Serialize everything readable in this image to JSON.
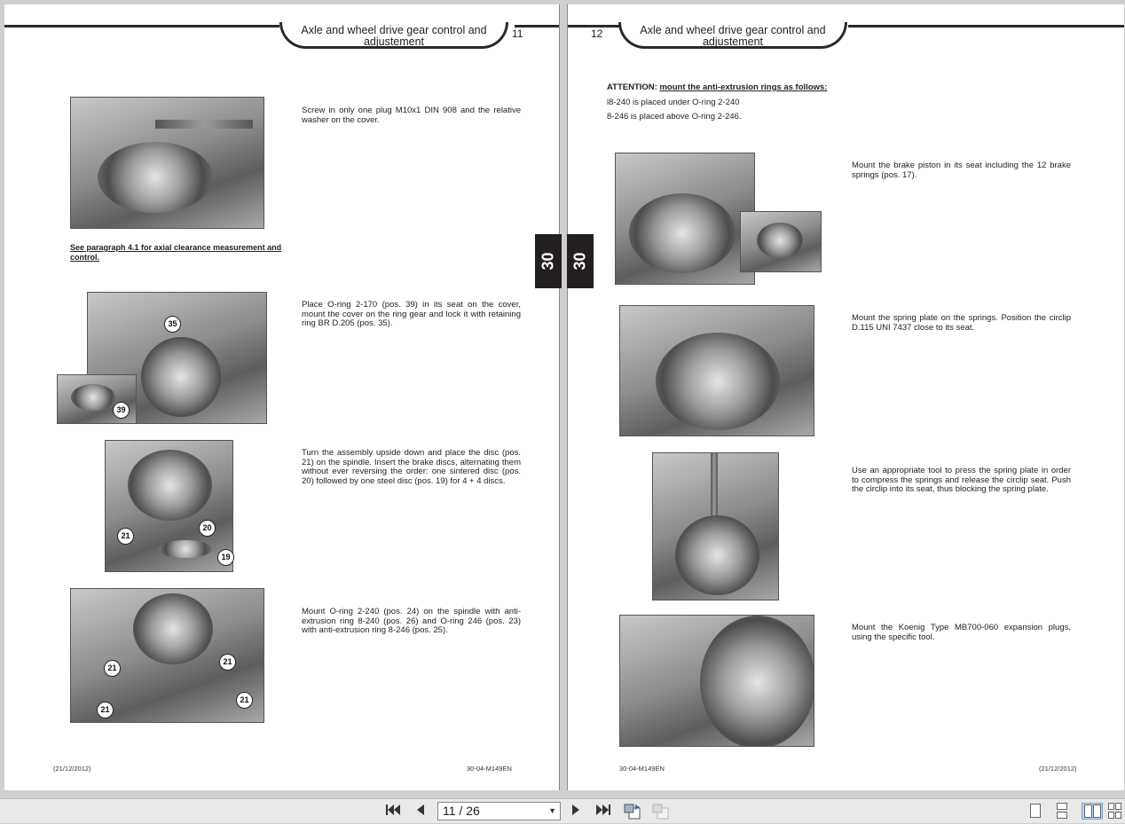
{
  "left_page": {
    "header_title": "Axle and wheel drive gear control and adjustement",
    "page_number": "11",
    "side_tab": "30",
    "note_link": "See paragraph 4.1 for axial clearance measurement and control.",
    "steps": [
      {
        "text": "Screw in only one plug M10x1 DIN 908 and the relative washer on the cover.",
        "image": "photo-plug-tightening",
        "callouts": []
      },
      {
        "text": "Place O-ring 2-170 (pos. 39) in its seat on the cover, mount the cover on the ring gear and lock it with retaining ring BR D.205 (pos. 35).",
        "image": "photo-cover-mounting",
        "callouts": [
          "35",
          "39"
        ]
      },
      {
        "text": "Turn the assembly upside down and place the disc (pos. 21) on the spindle. Insert the brake discs, alternating them without ever reversing the order: one sintered disc (pos. 20) followed by one steel disc (pos. 19) for 4 + 4 discs.",
        "image": "photo-brake-discs",
        "callouts": [
          "21",
          "20",
          "19"
        ]
      },
      {
        "text": "Mount O-ring 2-240 (pos. 24) on the spindle with anti-extrusion ring 8-240 (pos. 26) and O-ring 246 (pos. 23) with anti-extrusion ring 8-246 (pos. 25).",
        "image": "photo-o-rings",
        "callouts": [
          "21",
          "21",
          "21",
          "21"
        ]
      }
    ],
    "footer_date": "(21/12/2012)",
    "footer_code": "30-04-M149EN"
  },
  "right_page": {
    "header_title": "Axle and wheel drive gear control and adjustement",
    "page_number": "12",
    "side_tab": "30",
    "attention_label": "ATTENTION:",
    "attention_text": "mount the anti-extrusion rings as follows:",
    "attention_line1": "l8-240 is placed under O-ring 2-240",
    "attention_line2": "8-246 is placed above O-ring 2-246.",
    "steps": [
      {
        "text": "Mount the brake piston in its seat including the 12 brake springs (pos. 17).",
        "image": "photo-brake-piston"
      },
      {
        "text": "Mount the spring plate on the springs. Position the circlip D.115 UNI 7437 close to its seat.",
        "image": "photo-spring-plate"
      },
      {
        "text": "Use an appropriate tool to press the spring plate in order to compress the springs and release the circlip seat. Push the circlip into its seat, thus blocking the spring plate.",
        "image": "photo-press-tool"
      },
      {
        "text": "Mount the Koenig Type MB700-060 expansion plugs, using the specific tool.",
        "image": "photo-expansion-plugs"
      }
    ],
    "footer_code": "30-04-M149EN",
    "footer_date": "(21/12/2012)"
  },
  "toolbar": {
    "page_indicator": "11 / 26",
    "buttons": [
      "first-page-icon",
      "previous-page-icon",
      "next-page-icon",
      "last-page-icon",
      "previous-view-icon",
      "next-view-icon"
    ],
    "view_modes": [
      "single-page-icon",
      "continuous-page-icon",
      "two-page-icon",
      "continuous-two-page-icon"
    ],
    "active_view_mode": "two-page-icon"
  }
}
